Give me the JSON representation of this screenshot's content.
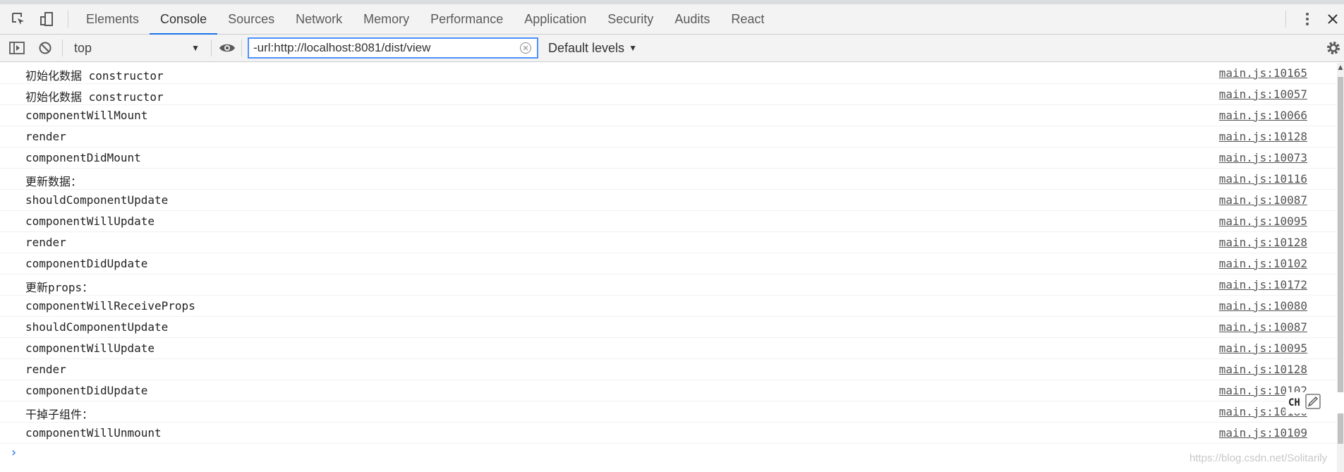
{
  "tabs": [
    "Elements",
    "Console",
    "Sources",
    "Network",
    "Memory",
    "Performance",
    "Application",
    "Security",
    "Audits",
    "React"
  ],
  "active_tab": "Console",
  "toolbar": {
    "context": "top",
    "filter_value": "-url:http://localhost:8081/dist/view",
    "levels": "Default levels"
  },
  "messages": [
    {
      "text": "初始化数据 constructor",
      "source": "main.js:10165"
    },
    {
      "text": "初始化数据 constructor",
      "source": "main.js:10057"
    },
    {
      "text": "componentWillMount",
      "source": "main.js:10066"
    },
    {
      "text": "render",
      "source": "main.js:10128"
    },
    {
      "text": "componentDidMount",
      "source": "main.js:10073"
    },
    {
      "text": "更新数据：",
      "source": "main.js:10116"
    },
    {
      "text": "shouldComponentUpdate",
      "source": "main.js:10087"
    },
    {
      "text": "componentWillUpdate",
      "source": "main.js:10095"
    },
    {
      "text": "render",
      "source": "main.js:10128"
    },
    {
      "text": "componentDidUpdate",
      "source": "main.js:10102"
    },
    {
      "text": "更新props：",
      "source": "main.js:10172"
    },
    {
      "text": "componentWillReceiveProps",
      "source": "main.js:10080"
    },
    {
      "text": "shouldComponentUpdate",
      "source": "main.js:10087"
    },
    {
      "text": "componentWillUpdate",
      "source": "main.js:10095"
    },
    {
      "text": "render",
      "source": "main.js:10128"
    },
    {
      "text": "componentDidUpdate",
      "source": "main.js:10102"
    },
    {
      "text": "干掉子组件：",
      "source": "main.js:10180"
    },
    {
      "text": "componentWillUnmount",
      "source": "main.js:10109"
    }
  ],
  "prompt_symbol": "›",
  "ime_label": "CH",
  "watermark": "https://blog.csdn.net/Solitarily",
  "colors": {
    "accent": "#1a73e8",
    "filter_border": "#4d90fe"
  }
}
